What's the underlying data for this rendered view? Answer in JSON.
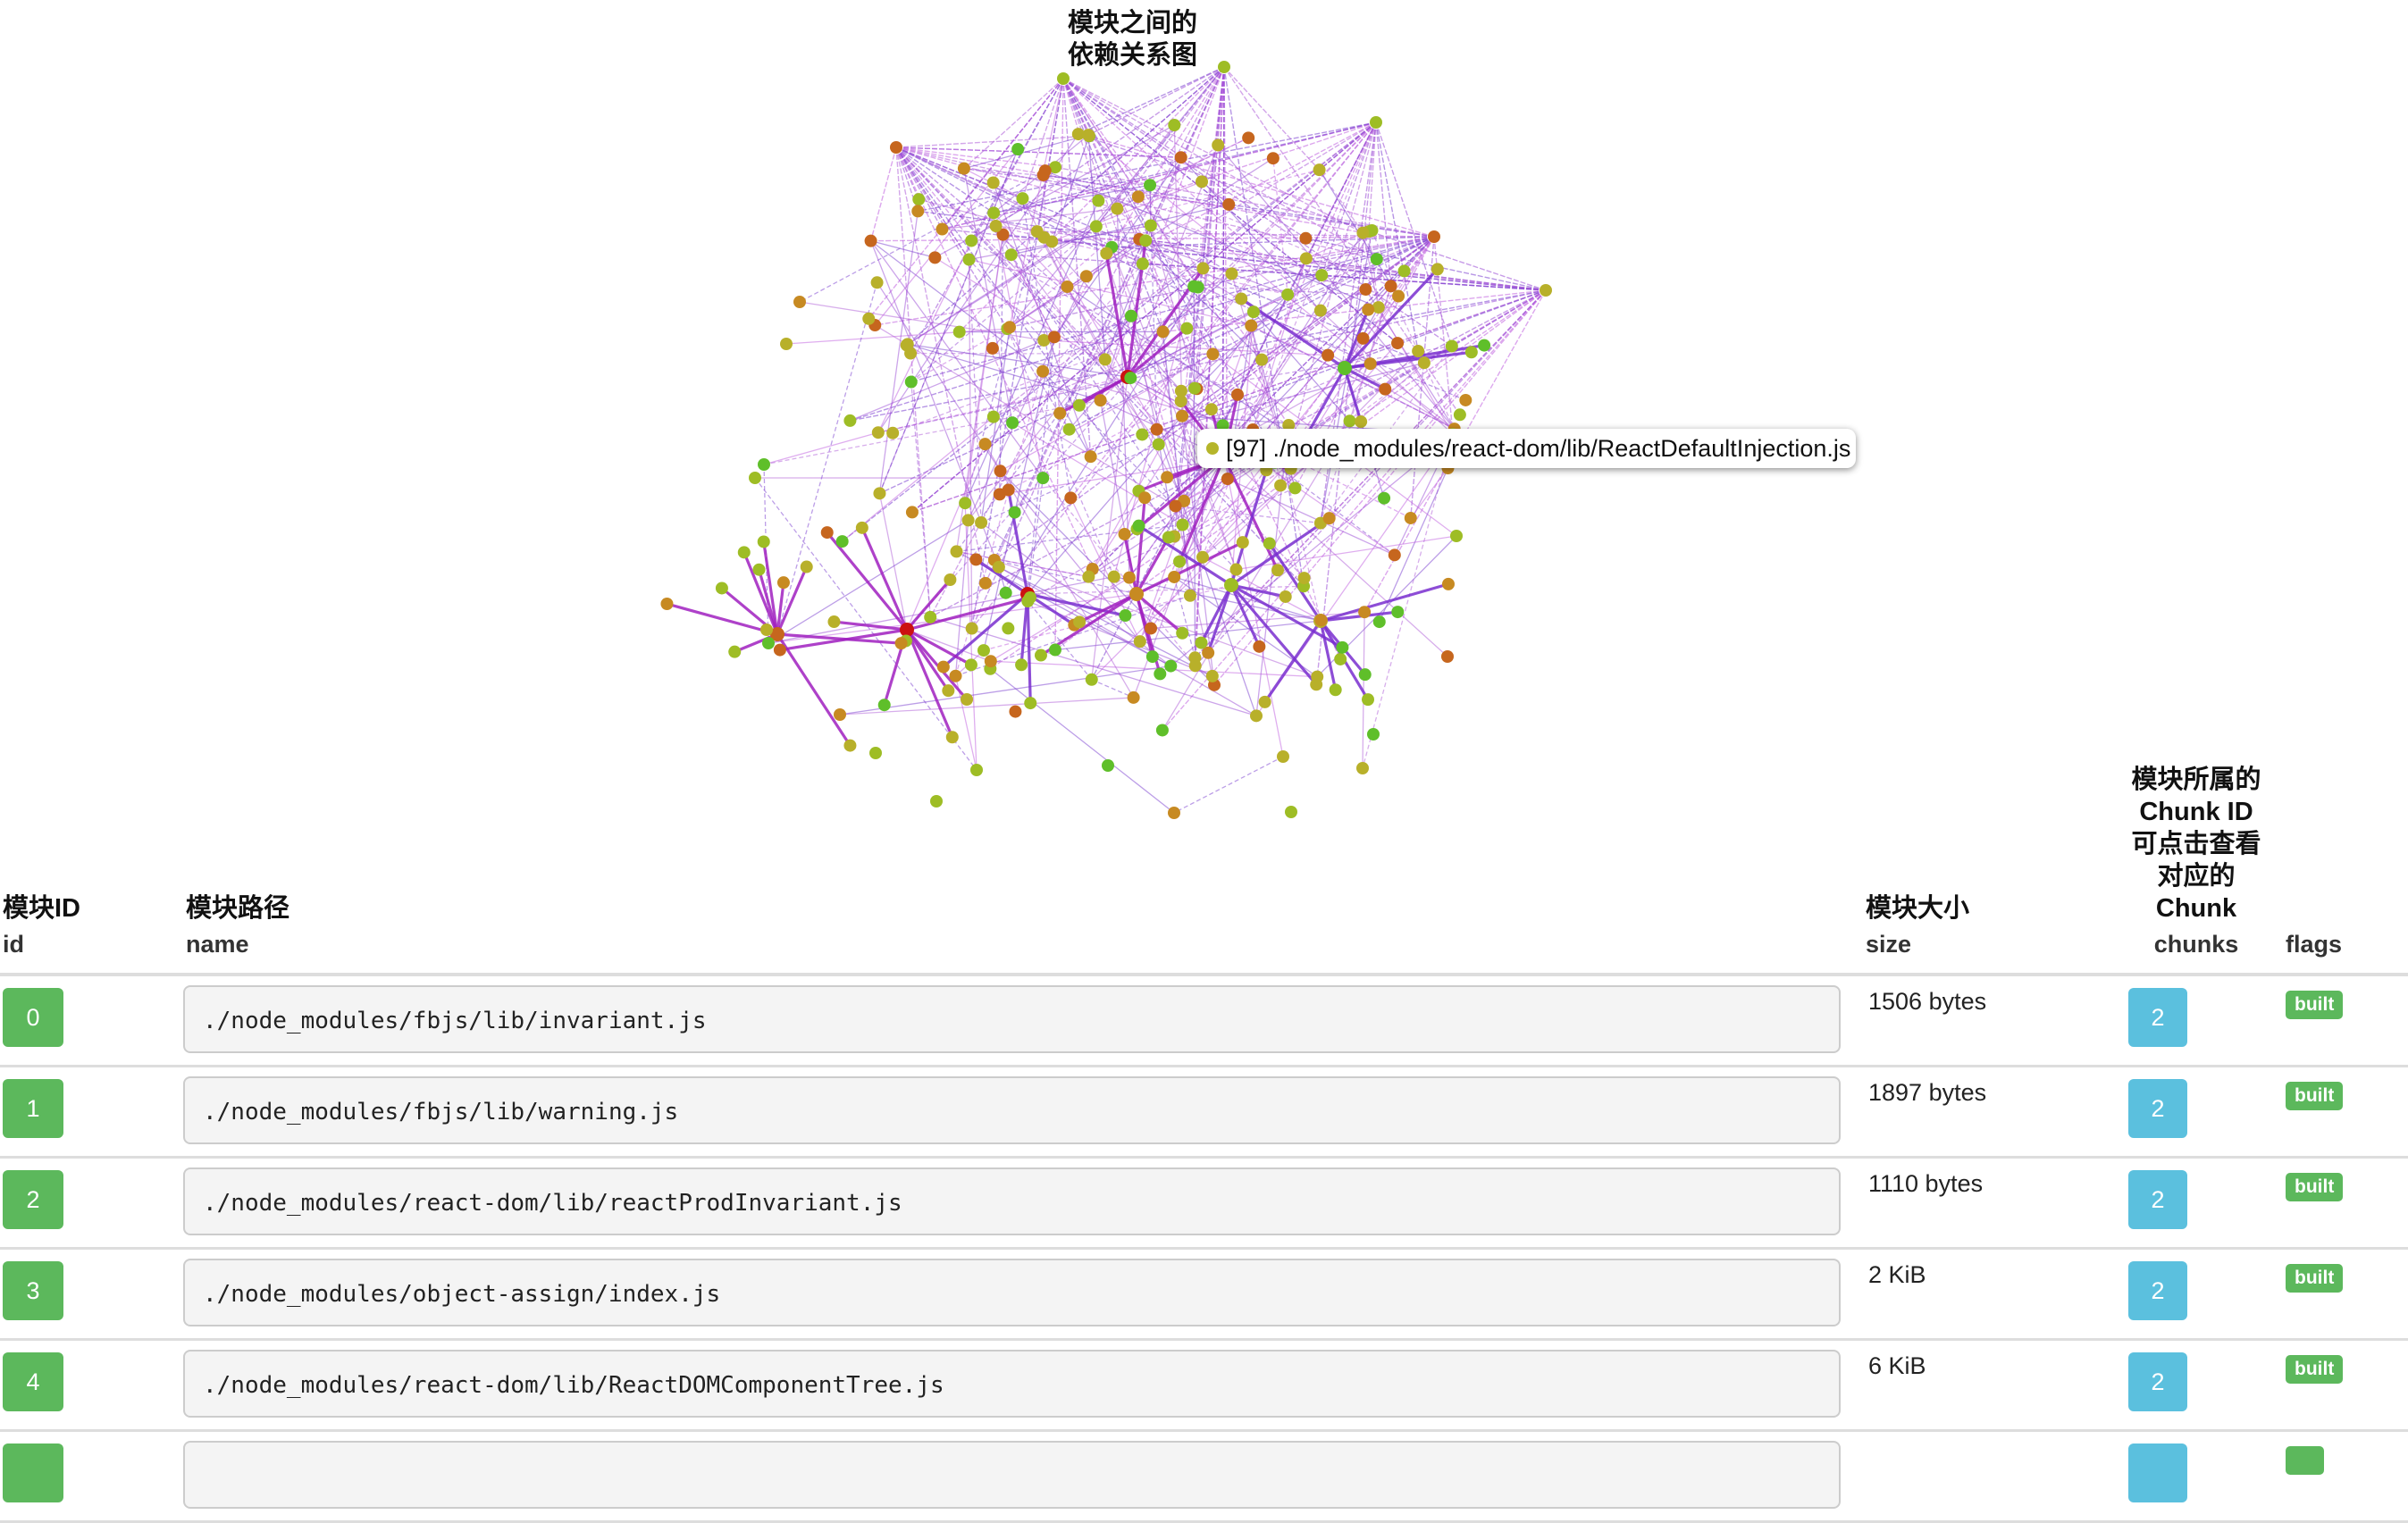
{
  "graph": {
    "caption_line1": "模块之间的",
    "caption_line2": "依赖关系图",
    "tooltip": {
      "text": "[97] ./node_modules/react-dom/lib/ReactDefaultInjection.js",
      "dot_color": "#b5b52a"
    },
    "edge_colors": [
      "#9b4dd6",
      "#b05fd9",
      "#7b3fd0",
      "#c060e0"
    ],
    "node_colors": {
      "green": "#5fbf2a",
      "yellow_green": "#9ebd25",
      "olive": "#b8b02a",
      "orange": "#c78a22",
      "dark_orange": "#c6661e",
      "red": "#cc1111"
    }
  },
  "table": {
    "headers": {
      "id": {
        "cn": "模块ID",
        "en": "id"
      },
      "name": {
        "cn": "模块路径",
        "en": "name"
      },
      "size": {
        "cn": "模块大小",
        "en": "size"
      },
      "chunks": {
        "cn_lines": [
          "模块所属的",
          "Chunk ID",
          "可点击查看",
          "对应的",
          "Chunk"
        ],
        "en": "chunks"
      },
      "flags": {
        "cn": "",
        "en": "flags"
      }
    },
    "rows": [
      {
        "id": "0",
        "name": "./node_modules/fbjs/lib/invariant.js",
        "size": "1506 bytes",
        "chunks": "2",
        "flag": "built"
      },
      {
        "id": "1",
        "name": "./node_modules/fbjs/lib/warning.js",
        "size": "1897 bytes",
        "chunks": "2",
        "flag": "built"
      },
      {
        "id": "2",
        "name": "./node_modules/react-dom/lib/reactProdInvariant.js",
        "size": "1110 bytes",
        "chunks": "2",
        "flag": "built"
      },
      {
        "id": "3",
        "name": "./node_modules/object-assign/index.js",
        "size": "2 KiB",
        "chunks": "2",
        "flag": "built"
      },
      {
        "id": "4",
        "name": "./node_modules/react-dom/lib/ReactDOMComponentTree.js",
        "size": "6 KiB",
        "chunks": "2",
        "flag": "built"
      },
      {
        "id": "",
        "name": "",
        "size": "",
        "chunks": "",
        "flag": ""
      }
    ]
  }
}
